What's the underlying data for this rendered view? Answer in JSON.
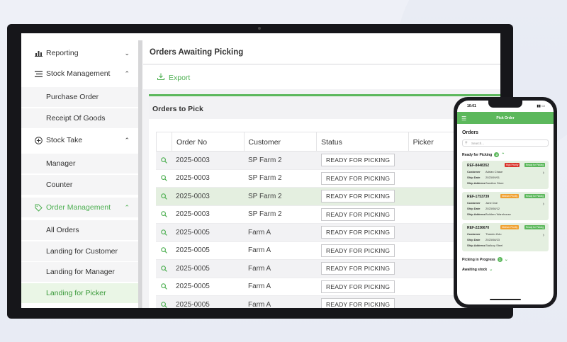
{
  "sidebar": {
    "items": [
      {
        "label": "Reporting",
        "icon": "bar-chart-icon",
        "chevron": "down"
      },
      {
        "label": "Stock Management",
        "icon": "list-icon",
        "chevron": "up"
      },
      {
        "label": "Purchase Order"
      },
      {
        "label": "Receipt Of Goods"
      },
      {
        "label": "Stock Take",
        "icon": "plus-circle-icon",
        "chevron": "up"
      },
      {
        "label": "Manager"
      },
      {
        "label": "Counter"
      },
      {
        "label": "Order Management",
        "icon": "tag-icon",
        "chevron": "up"
      },
      {
        "label": "All Orders"
      },
      {
        "label": "Landing for Customer"
      },
      {
        "label": "Landing for Manager"
      },
      {
        "label": "Landing for Picker"
      }
    ]
  },
  "main": {
    "title": "Orders Awaiting Picking",
    "export_label": "Export",
    "card_title": "Orders to Pick",
    "columns": [
      "Order No",
      "Customer",
      "Status",
      "Picker"
    ],
    "rows": [
      {
        "order": "2025-0003",
        "customer": "SP Farm 2",
        "status": "READY FOR PICKING"
      },
      {
        "order": "2025-0003",
        "customer": "SP Farm 2",
        "status": "READY FOR PICKING"
      },
      {
        "order": "2025-0003",
        "customer": "SP Farm 2",
        "status": "READY FOR PICKING"
      },
      {
        "order": "2025-0003",
        "customer": "SP Farm 2",
        "status": "READY FOR PICKING"
      },
      {
        "order": "2025-0005",
        "customer": "Farm A",
        "status": "READY FOR PICKING"
      },
      {
        "order": "2025-0005",
        "customer": "Farm A",
        "status": "READY FOR PICKING"
      },
      {
        "order": "2025-0005",
        "customer": "Farm A",
        "status": "READY FOR PICKING"
      },
      {
        "order": "2025-0005",
        "customer": "Farm A",
        "status": "READY FOR PICKING"
      },
      {
        "order": "2025-0005",
        "customer": "Farm A",
        "status": "READY FOR PICKING"
      }
    ]
  },
  "phone": {
    "time": "10:01",
    "bar_title": "Pick Order",
    "heading": "Orders",
    "search_placeholder": "Search...",
    "sections": {
      "ready": {
        "label": "Ready for Picking",
        "count": "3"
      },
      "progress": {
        "label": "Picking in Progress",
        "count": "1"
      },
      "awaiting": {
        "label": "Awaiting stock"
      }
    },
    "field_labels": {
      "customer": "Customer",
      "ship_date": "Ship Date",
      "ship_address": "Ship Address"
    },
    "cards": [
      {
        "ref": "REF-8448352",
        "priority": "High Priority",
        "status": "Ready for Picking",
        "customer": "Adrian Chase",
        "ship_date": "2023/09/01",
        "ship_address": "Sandton Store"
      },
      {
        "ref": "REF-1753739",
        "priority": "Medium Priority",
        "status": "Ready for Picking",
        "customer": "Jane Doe",
        "ship_date": "2023/08/12",
        "ship_address": "Builders Warehouse"
      },
      {
        "ref": "REF-2236670",
        "priority": "Medium Priority",
        "status": "Ready for Picking",
        "customer": "Thando Zulu",
        "ship_date": "2023/08/23",
        "ship_address": "Stallcoy Steel"
      }
    ]
  },
  "colors": {
    "accent": "#4caf50",
    "high_priority": "#d9342b",
    "medium_priority": "#f0a030",
    "ready": "#5cb85c"
  }
}
